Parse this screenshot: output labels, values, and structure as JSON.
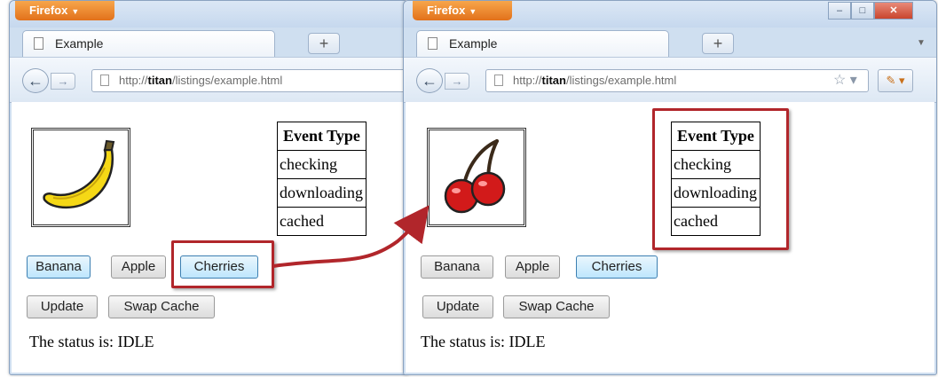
{
  "browser_menu": "Firefox",
  "tab_title": "Example",
  "new_tab": "+",
  "url": {
    "prefix": "http://",
    "host": "titan",
    "path": "/listings/example.html"
  },
  "window_controls": {
    "minimize": "–",
    "maximize": "□",
    "close": "✕"
  },
  "event_table": {
    "header": "Event Type",
    "rows": [
      "checking",
      "downloading",
      "cached"
    ]
  },
  "buttons": {
    "banana": "Banana",
    "apple": "Apple",
    "cherries": "Cherries",
    "update": "Update",
    "swap_cache": "Swap Cache"
  },
  "status_text": "The status is: IDLE",
  "images": {
    "left": "banana",
    "right": "cherries"
  },
  "colors": {
    "highlight": "#b1262b",
    "firefox_button": "#e2711b",
    "focused_button": "#bee6fd"
  }
}
